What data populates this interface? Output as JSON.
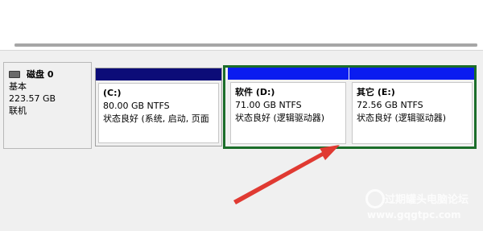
{
  "disk": {
    "name": "磁盘 0",
    "type": "基本",
    "size": "223.57 GB",
    "status": "联机"
  },
  "partitions": [
    {
      "title": "(C:)",
      "size_fs": "80.00 GB NTFS",
      "status": "状态良好 (系统, 启动, 页面"
    },
    {
      "title": "软件  (D:)",
      "size_fs": "71.00 GB NTFS",
      "status": "状态良好 (逻辑驱动器)"
    },
    {
      "title": "其它  (E:)",
      "size_fs": "72.56 GB NTFS",
      "status": "状态良好 (逻辑驱动器)"
    }
  ],
  "colors": {
    "primary_partition_header": "#0c0c78",
    "logical_partition_header": "#0a1cf0",
    "selection_outline": "#1b6d2a",
    "annotation_arrow": "#e03a32"
  },
  "watermark": {
    "text": "过期罐头电脑论坛",
    "url": "www.gqgtpc.com"
  }
}
